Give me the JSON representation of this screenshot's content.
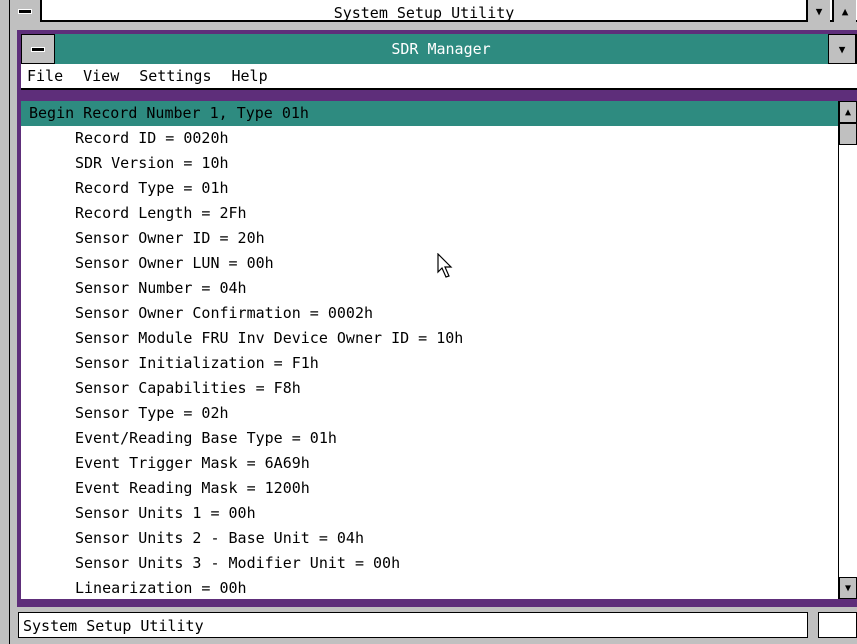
{
  "outer_window": {
    "title": "System Setup Utility",
    "min_glyph": "▼",
    "max_glyph": "▲"
  },
  "inner_window": {
    "title": "SDR Manager",
    "min_glyph": "▼",
    "max_glyph": "▲"
  },
  "menu": {
    "items": [
      {
        "label": "File"
      },
      {
        "label": "View"
      },
      {
        "label": "Settings"
      },
      {
        "label": "Help"
      }
    ]
  },
  "records": {
    "header": "Begin Record Number 1, Type 01h",
    "lines": [
      "Record ID = 0020h",
      "SDR Version = 10h",
      "Record Type = 01h",
      "Record Length = 2Fh",
      "Sensor Owner ID = 20h",
      "Sensor Owner LUN = 00h",
      "Sensor Number = 04h",
      "Sensor Owner Confirmation = 0002h",
      "Sensor Module FRU Inv Device Owner ID = 10h",
      "Sensor Initialization = F1h",
      "Sensor Capabilities = F8h",
      "Sensor Type = 02h",
      "Event/Reading Base Type = 01h",
      "Event Trigger Mask = 6A69h",
      "Event Reading Mask = 1200h",
      "Sensor Units 1 = 00h",
      "Sensor Units 2 - Base Unit = 04h",
      "Sensor Units 3 - Modifier Unit = 00h",
      "Linearization = 00h"
    ]
  },
  "scrollbar": {
    "up_glyph": "▲",
    "down_glyph": "▼"
  },
  "status": {
    "text": "System Setup Utility"
  },
  "colors": {
    "titlebar": "#2e8b80",
    "frame": "#5e2e7a",
    "chrome": "#c0c0c0"
  }
}
